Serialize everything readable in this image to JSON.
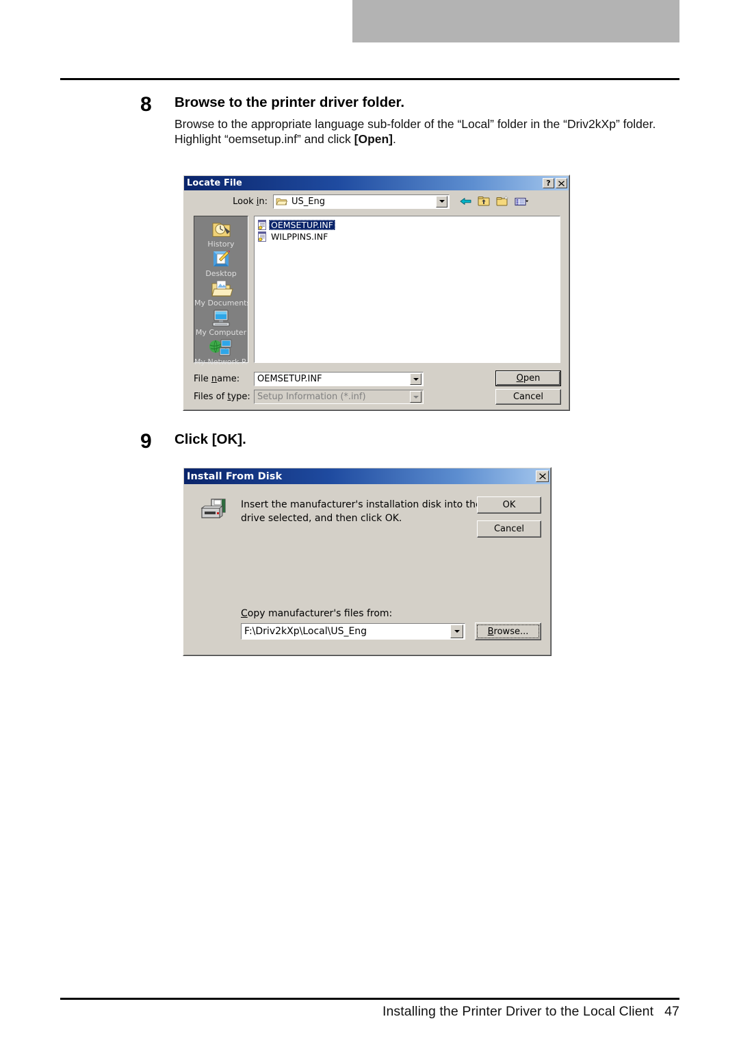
{
  "page": {
    "footer_text": "Installing the Printer Driver to the Local Client",
    "page_number": "47"
  },
  "steps": [
    {
      "number": "8",
      "title": "Browse to the printer driver folder.",
      "para1": "Browse to the appropriate language sub-folder of the “Local” folder in the “Driv2kXp” folder.",
      "para2_pre": "Highlight “oemsetup.inf” and click ",
      "para2_bold": "[Open]",
      "para2_post": "."
    },
    {
      "number": "9",
      "title": "Click [OK]."
    }
  ],
  "locate_file_dialog": {
    "title": "Locate File",
    "help_button": "?",
    "close_button": "✕",
    "lookin_label": "Look in:",
    "lookin_value": "US_Eng",
    "toolbar": [
      {
        "name": "back-icon",
        "tooltip": "Back"
      },
      {
        "name": "up-one-level-icon",
        "tooltip": "Up One Level"
      },
      {
        "name": "new-folder-icon",
        "tooltip": "Create New Folder"
      },
      {
        "name": "views-icon",
        "tooltip": "Views"
      }
    ],
    "places": [
      {
        "label": "History",
        "icon": "history-folder-icon"
      },
      {
        "label": "Desktop",
        "icon": "desktop-icon"
      },
      {
        "label": "My Documents",
        "icon": "my-documents-icon"
      },
      {
        "label": "My Computer",
        "icon": "my-computer-icon"
      },
      {
        "label": "My Network P...",
        "icon": "my-network-places-icon"
      }
    ],
    "files": [
      {
        "name": "OEMSETUP.INF",
        "selected": true
      },
      {
        "name": "WILPPINS.INF",
        "selected": false
      }
    ],
    "filename_label": "File name:",
    "filename_value": "OEMSETUP.INF",
    "filetype_label": "Files of type:",
    "filetype_value": "Setup Information (*.inf)",
    "filetype_disabled": true,
    "open_button": "Open",
    "cancel_button": "Cancel"
  },
  "install_from_disk_dialog": {
    "title": "Install From Disk",
    "close_button": "✕",
    "icon": "floppy-drive-icon",
    "message": "Insert the manufacturer's installation disk into the drive selected, and then click OK.",
    "ok_button": "OK",
    "cancel_button": "Cancel",
    "copy_from_label": "Copy manufacturer's files from:",
    "copy_from_value": "F:\\Driv2kXp\\Local\\US_Eng",
    "browse_button": "Browse..."
  },
  "colors": {
    "dialog_face": "#d4d0c8",
    "titlebar_start": "#0a246a",
    "titlebar_end": "#a6c8ee",
    "selection": "#0a246a",
    "places_bar": "#808080",
    "header_bar": "#b3b3b3"
  }
}
